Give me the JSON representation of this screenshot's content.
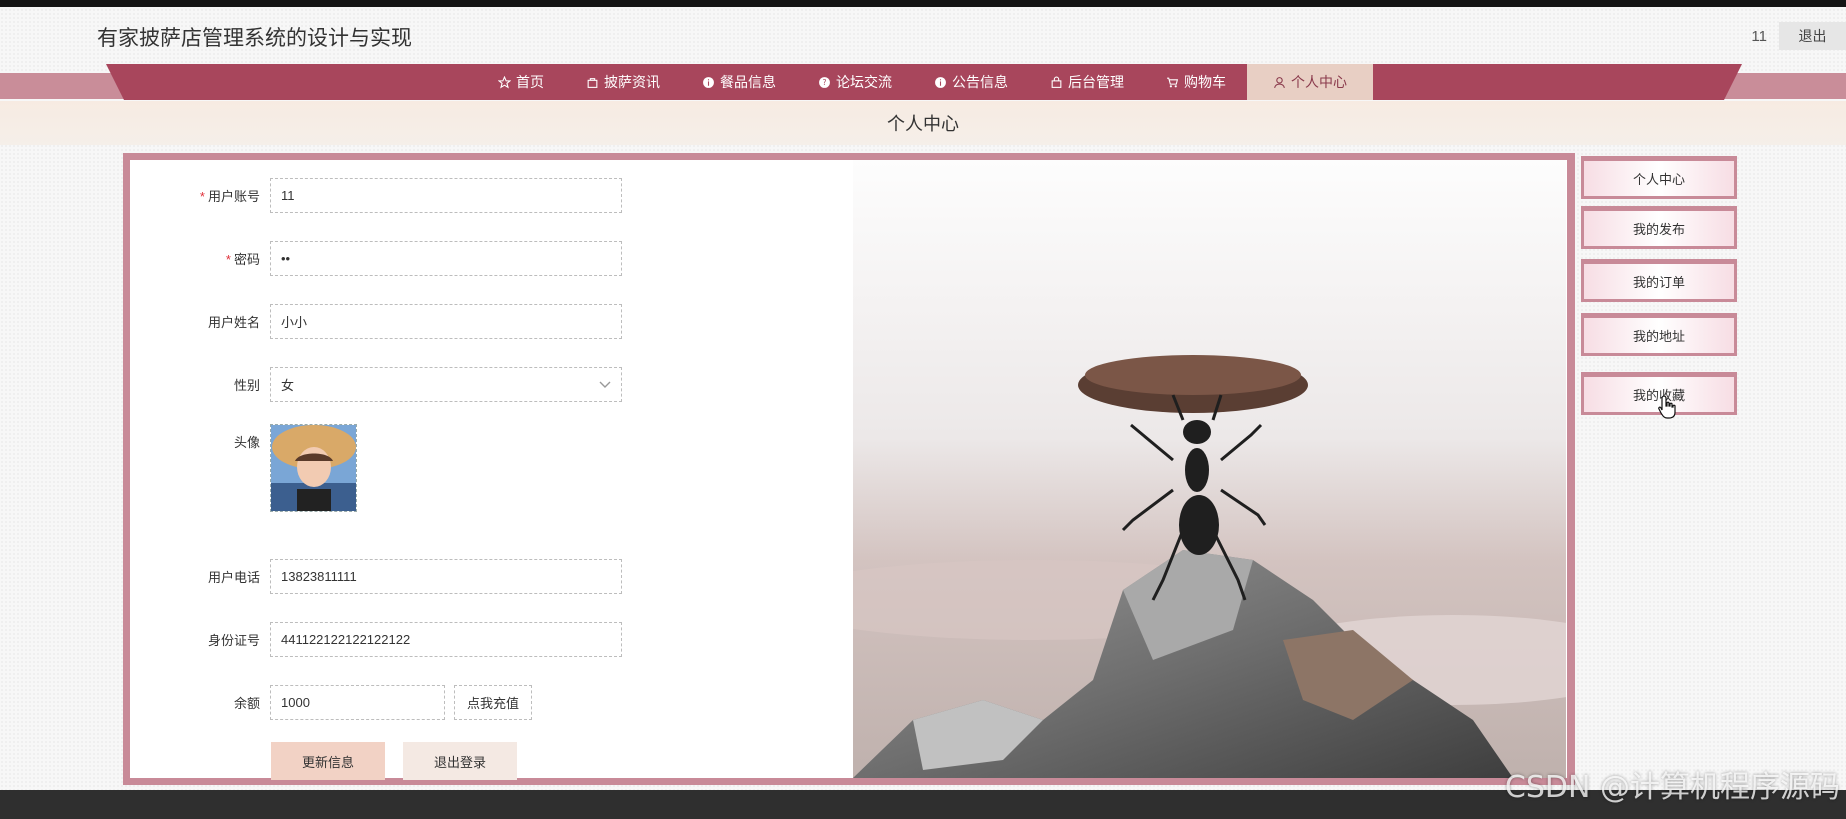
{
  "header": {
    "app_title": "有家披萨店管理系统的设计与实现",
    "username": "11",
    "logout_label": "退出"
  },
  "nav": {
    "items": [
      {
        "label": "首页",
        "icon": "star-icon"
      },
      {
        "label": "披萨资讯",
        "icon": "bag-icon"
      },
      {
        "label": "餐品信息",
        "icon": "info-icon"
      },
      {
        "label": "论坛交流",
        "icon": "question-icon"
      },
      {
        "label": "公告信息",
        "icon": "info-icon"
      },
      {
        "label": "后台管理",
        "icon": "lock-icon"
      },
      {
        "label": "购物车",
        "icon": "cart-icon"
      },
      {
        "label": "个人中心",
        "icon": "user-icon"
      }
    ],
    "active": "个人中心"
  },
  "breadcrumb": {
    "title": "个人中心"
  },
  "form": {
    "account": {
      "label": "用户账号",
      "value": "11",
      "required": true
    },
    "password": {
      "label": "密码",
      "value": "••",
      "required": true
    },
    "name": {
      "label": "用户姓名",
      "value": "小小"
    },
    "gender": {
      "label": "性别",
      "value": "女"
    },
    "avatar": {
      "label": "头像"
    },
    "phone": {
      "label": "用户电话",
      "value": "13823811111"
    },
    "id_card": {
      "label": "身份证号",
      "value": "441122122122122122"
    },
    "balance": {
      "label": "余额",
      "value": "1000",
      "recharge_label": "点我充值"
    },
    "update_label": "更新信息",
    "logout_label": "退出登录",
    "required_mark": "*"
  },
  "sidebar": {
    "items": [
      {
        "label": "个人中心"
      },
      {
        "label": "我的发布"
      },
      {
        "label": "我的订单"
      },
      {
        "label": "我的地址"
      },
      {
        "label": "我的收藏"
      }
    ]
  },
  "watermark": "CSDN @计算机程序源码",
  "colors": {
    "nav": "#a8465c",
    "accent": "#c88a98",
    "active_tab": "#e8cfc4",
    "update_btn": "#f2d2c5",
    "logout_btn": "#f4e9e3"
  }
}
